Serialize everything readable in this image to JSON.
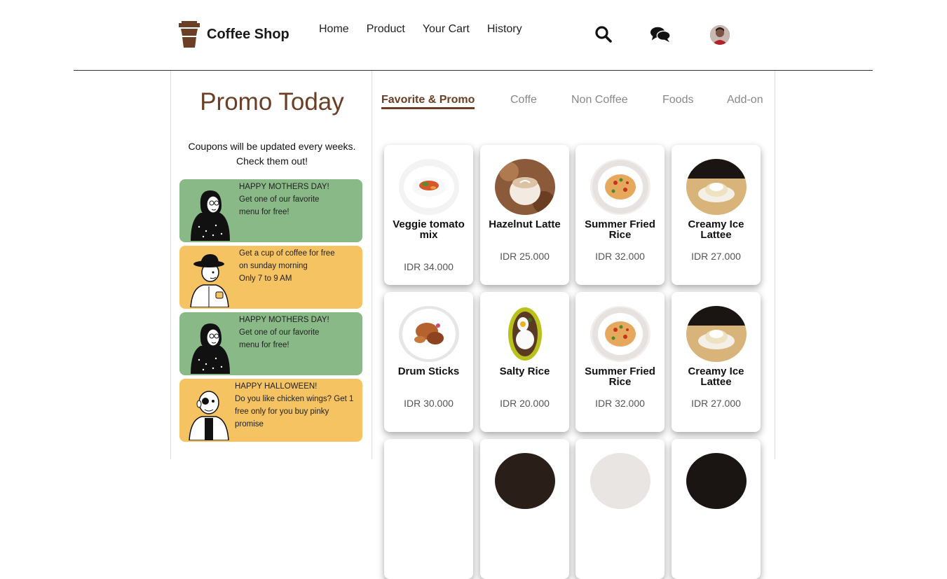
{
  "header": {
    "brand": "Coffee Shop",
    "nav": [
      "Home",
      "Product",
      "Your Cart",
      "History"
    ],
    "icons": [
      "search-icon",
      "chat-icon",
      "user-avatar"
    ]
  },
  "promo": {
    "title": "Promo Today",
    "description": "Coupons will be updated every weeks. Check them out!",
    "coupons": [
      {
        "color": "#88b987",
        "lines": [
          "HAPPY MOTHERS DAY!",
          "Get one of our favorite",
          "menu for free!"
        ]
      },
      {
        "color": "#f5c361",
        "lines": [
          "Get a cup of coffee for free",
          "on sunday morning",
          "Only 7 to 9 AM"
        ]
      },
      {
        "color": "#88b987",
        "lines": [
          "HAPPY MOTHERS DAY!",
          "Get one of our favorite",
          "menu for free!"
        ]
      },
      {
        "color": "#f5c361",
        "lines": [
          "HAPPY HALLOWEEN!",
          "Do you like chicken wings? Get 1",
          "free only for you buy pinky",
          "promise"
        ]
      }
    ]
  },
  "tabs": [
    "Favorite & Promo",
    "Coffe",
    "Non Coffee",
    "Foods",
    "Add-on"
  ],
  "products": [
    {
      "name": "Veggie tomato mix",
      "price": "IDR 34.000"
    },
    {
      "name": "Hazelnut Latte",
      "price": "IDR 25.000"
    },
    {
      "name": "Summer Fried Rice",
      "price": "IDR 32.000"
    },
    {
      "name": "Creamy Ice Lattee",
      "price": "IDR 27.000"
    },
    {
      "name": "Drum Sticks",
      "price": "IDR 30.000"
    },
    {
      "name": "Salty Rice",
      "price": "IDR 20.000"
    },
    {
      "name": "Summer Fried Rice",
      "price": "IDR 32.000"
    },
    {
      "name": "Creamy Ice Lattee",
      "price": "IDR 27.000"
    }
  ],
  "colors": {
    "brand_brown": "#6b3e26",
    "coupon_green": "#88b987",
    "coupon_yellow": "#f5c361"
  }
}
